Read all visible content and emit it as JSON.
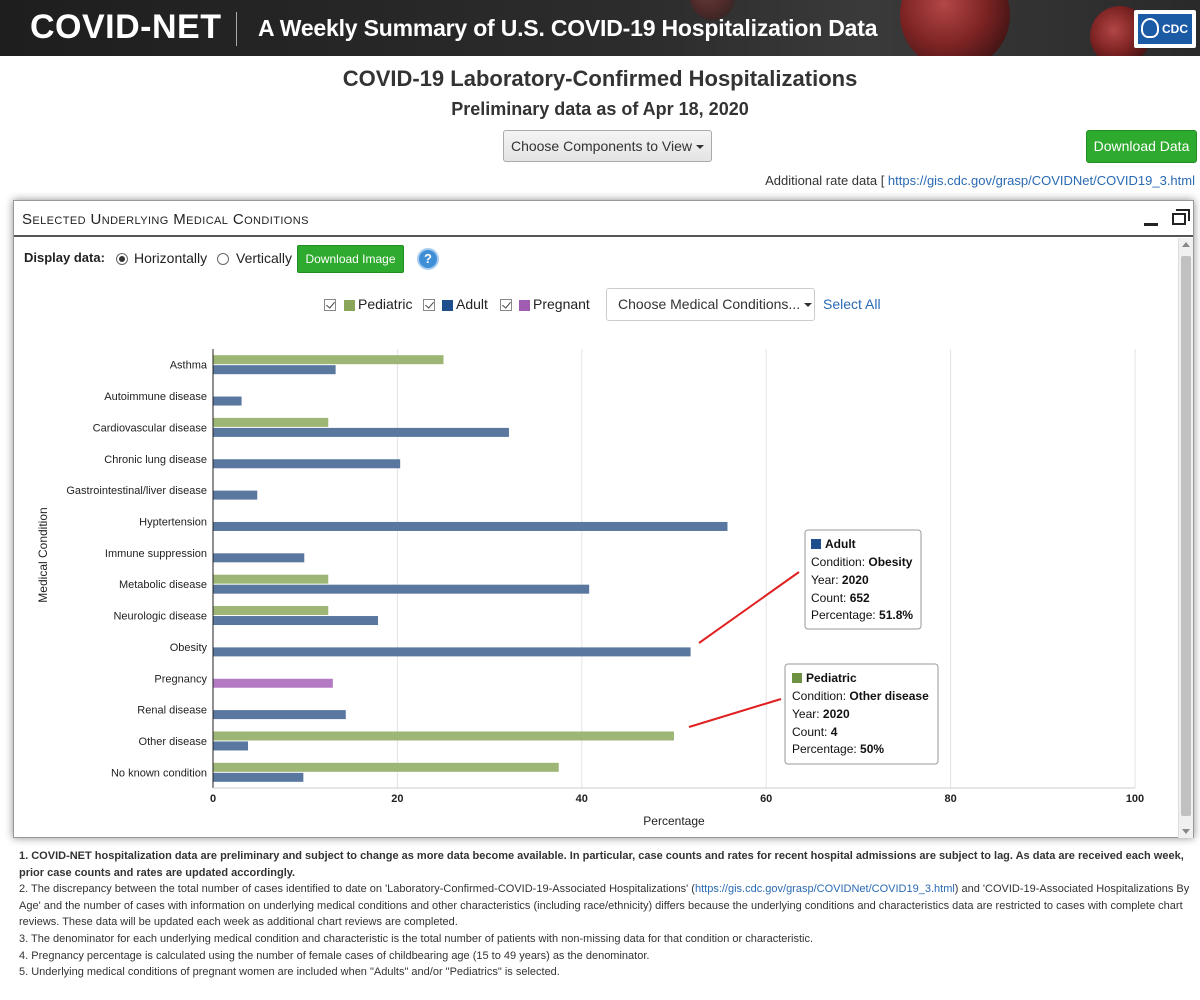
{
  "banner": {
    "brand": "COVID-NET",
    "subtitle": "A Weekly Summary of U.S. COVID-19 Hospitalization Data",
    "logo_text": "CDC"
  },
  "page": {
    "title": "COVID-19 Laboratory-Confirmed Hospitalizations",
    "subtitle": "Preliminary data as of Apr 18, 2020",
    "components_button": "Choose Components to View",
    "download_data_button": "Download Data",
    "rate_prefix": "Additional rate data [ ",
    "rate_link": "https://gis.cdc.gov/grasp/COVIDNet/COVID19_3.html"
  },
  "panel": {
    "title": "Selected Underlying Medical Conditions",
    "display_label": "Display data:",
    "option_horizontal": "Horizontally",
    "option_vertical": "Vertically",
    "download_image_button": "Download Image",
    "help_glyph": "?",
    "legend": [
      {
        "label": "Pediatric",
        "color": "#8aa65a"
      },
      {
        "label": "Adult",
        "color": "#1f4e8c"
      },
      {
        "label": "Pregnant",
        "color": "#a05cb0"
      }
    ],
    "choose_conditions": "Choose Medical Conditions...",
    "select_all": "Select All"
  },
  "chart_data": {
    "type": "bar",
    "orientation": "horizontal",
    "xlabel": "Percentage",
    "ylabel": "Medical Condition",
    "xlim": [
      0,
      100
    ],
    "xticks": [
      "0",
      "20",
      "40",
      "60",
      "80",
      "100"
    ],
    "categories": [
      "Asthma",
      "Autoimmune disease",
      "Cardiovascular disease",
      "Chronic lung disease",
      "Gastrointestinal/liver disease",
      "Hyptertension",
      "Immune suppression",
      "Metabolic disease",
      "Neurologic disease",
      "Obesity",
      "Pregnancy",
      "Renal disease",
      "Other disease",
      "No known condition"
    ],
    "series": [
      {
        "name": "Pediatric",
        "color": "#9db676",
        "values": [
          25,
          null,
          12.5,
          null,
          null,
          null,
          null,
          12.5,
          12.5,
          null,
          null,
          null,
          50,
          37.5
        ]
      },
      {
        "name": "Adult",
        "color": "#59779f",
        "values": [
          13.3,
          3.1,
          32.1,
          20.3,
          4.8,
          55.8,
          9.9,
          40.8,
          17.9,
          51.8,
          null,
          14.4,
          3.8,
          9.8
        ]
      },
      {
        "name": "Pregnant",
        "color": "#b57ac4",
        "values": [
          null,
          null,
          null,
          null,
          null,
          null,
          null,
          null,
          null,
          null,
          13,
          null,
          null,
          null
        ]
      }
    ],
    "tooltips": [
      {
        "series": "Adult",
        "color": "#1f4e8c",
        "condition_label": "Condition: ",
        "condition": "Obesity",
        "year_label": "Year: ",
        "year": "2020",
        "count_label": "Count: ",
        "count": "652",
        "pct_label": "Percentage: ",
        "pct": "51.8%"
      },
      {
        "series": "Pediatric",
        "color": "#6f9144",
        "condition_label": "Condition: ",
        "condition": "Other disease",
        "year_label": "Year: ",
        "year": "2020",
        "count_label": "Count: ",
        "count": "4",
        "pct_label": "Percentage: ",
        "pct": "50%"
      }
    ]
  },
  "notes": {
    "n1_a": "1. COVID-NET hospitalization data are preliminary and subject to change as more data become available. In particular, case counts and rates for recent hospital admissions are subject to lag. As data are received each week, prior case counts and rates are updated accordingly.",
    "n2_a": "2. The discrepancy between the total number of cases identified to date on 'Laboratory-Confirmed-COVID-19-Associated Hospitalizations' (",
    "n2_link": "https://gis.cdc.gov/grasp/COVIDNet/COVID19_3.html",
    "n2_b": ") and 'COVID-19-Associated Hospitalizations By Age' and the number of cases with information on underlying medical conditions and other characteristics (including race/ethnicity) differs because the underlying conditions and characteristics data are restricted to cases with complete chart reviews. These data will be updated each week as additional chart reviews are completed.",
    "n3": "3. The denominator for each underlying medical condition and characteristic is the total number of patients with non-missing data for that condition or characteristic.",
    "n4": "4. Pregnancy percentage is calculated using the number of female cases of childbearing age (15 to 49 years) as the denominator.",
    "n5": "5. Underlying medical conditions of pregnant women are included when \"Adults\" and/or \"Pediatrics\" is selected."
  }
}
